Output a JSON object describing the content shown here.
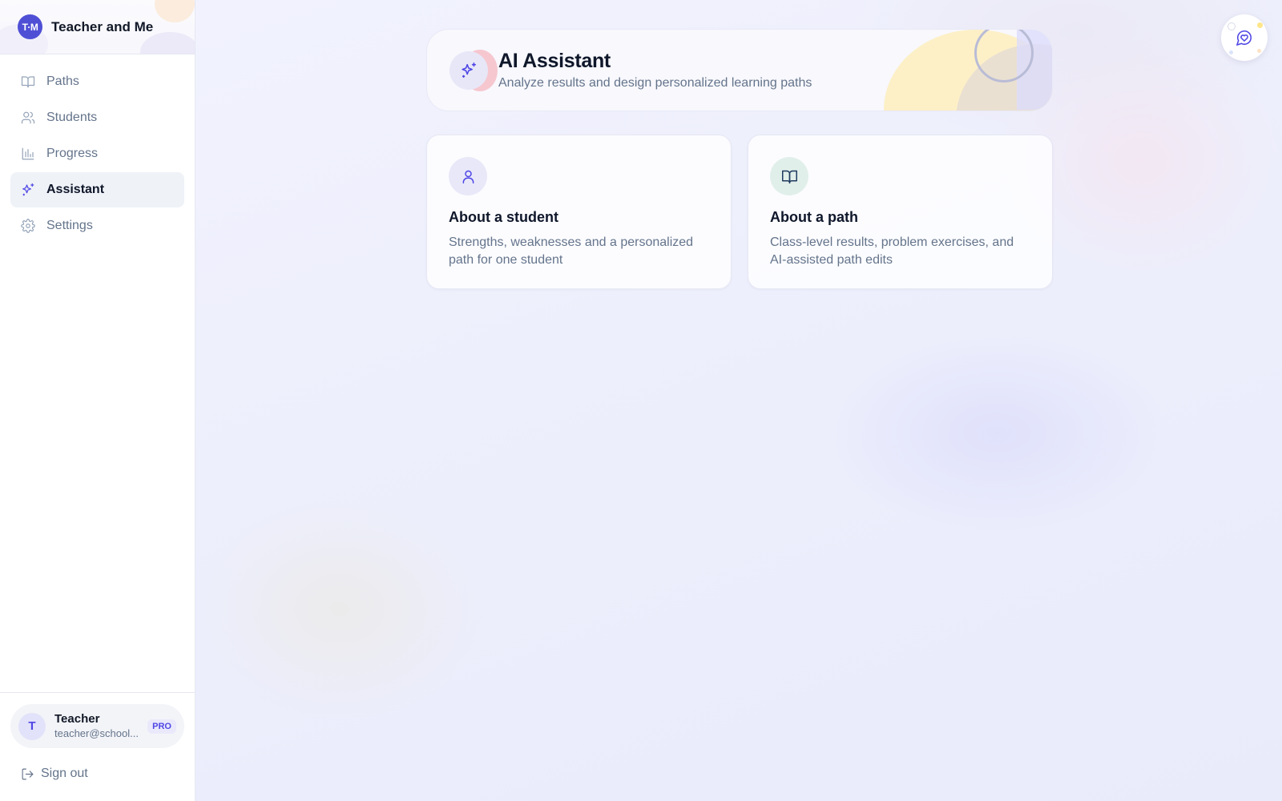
{
  "brand": {
    "logo_text": "T·M",
    "name": "Teacher and Me"
  },
  "sidebar": {
    "items": [
      {
        "label": "Paths",
        "icon": "book-open-icon",
        "active": false
      },
      {
        "label": "Students",
        "icon": "users-icon",
        "active": false
      },
      {
        "label": "Progress",
        "icon": "bar-chart-icon",
        "active": false
      },
      {
        "label": "Assistant",
        "icon": "sparkles-icon",
        "active": true
      },
      {
        "label": "Settings",
        "icon": "gear-icon",
        "active": false
      }
    ],
    "user": {
      "avatar_initial": "T",
      "name": "Teacher",
      "email": "teacher@school...",
      "badge": "PRO"
    },
    "signout_label": "Sign out"
  },
  "main": {
    "hero": {
      "title": "AI Assistant",
      "subtitle": "Analyze results and design personalized learning paths",
      "icon": "sparkles-icon"
    },
    "cards": [
      {
        "title": "About a student",
        "description": "Strengths, weaknesses and a personalized path for one student",
        "icon": "user-icon"
      },
      {
        "title": "About a path",
        "description": "Class-level results, problem exercises, and AI-assisted path edits",
        "icon": "book-open-icon"
      }
    ],
    "fab_icon": "chat-heart-icon"
  },
  "colors": {
    "accent": "#4f46e5",
    "logo_bg": "#4f4fd6",
    "active_nav_bg": "#eff2f7",
    "background": "#eef0fc"
  }
}
